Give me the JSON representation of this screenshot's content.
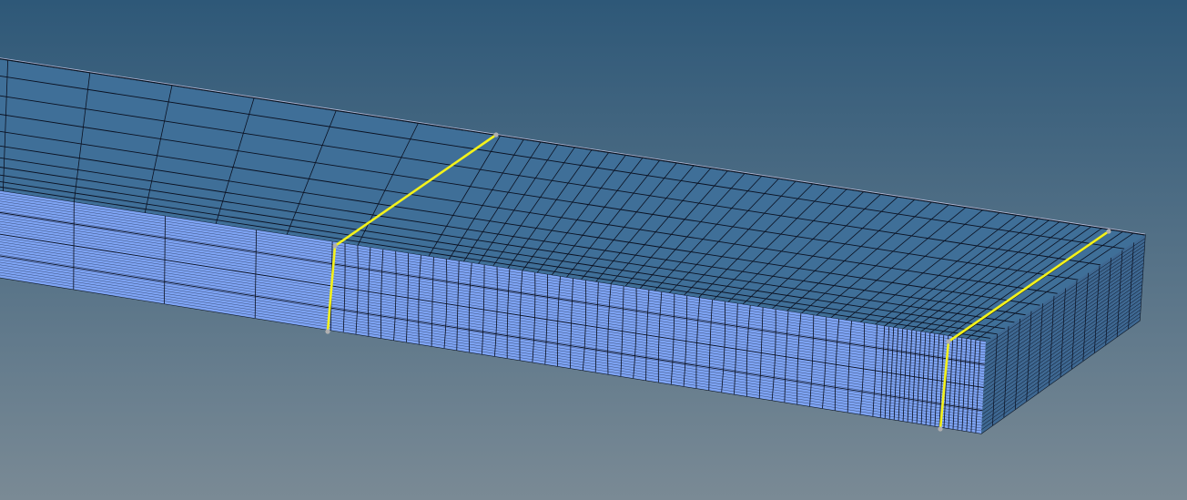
{
  "viewport": {
    "background_top": "#2e5878",
    "background_bottom": "#7a8a95"
  },
  "model": {
    "top_face_color": "#3f6f98",
    "front_face_color": "#7ea4f4",
    "end_face_color": "#3e6892",
    "mesh_line_color": "#0a1020",
    "selected_edge_color": "#f4f21a",
    "node_marker_color": "#b0b0b0",
    "selected_edges": 2
  }
}
